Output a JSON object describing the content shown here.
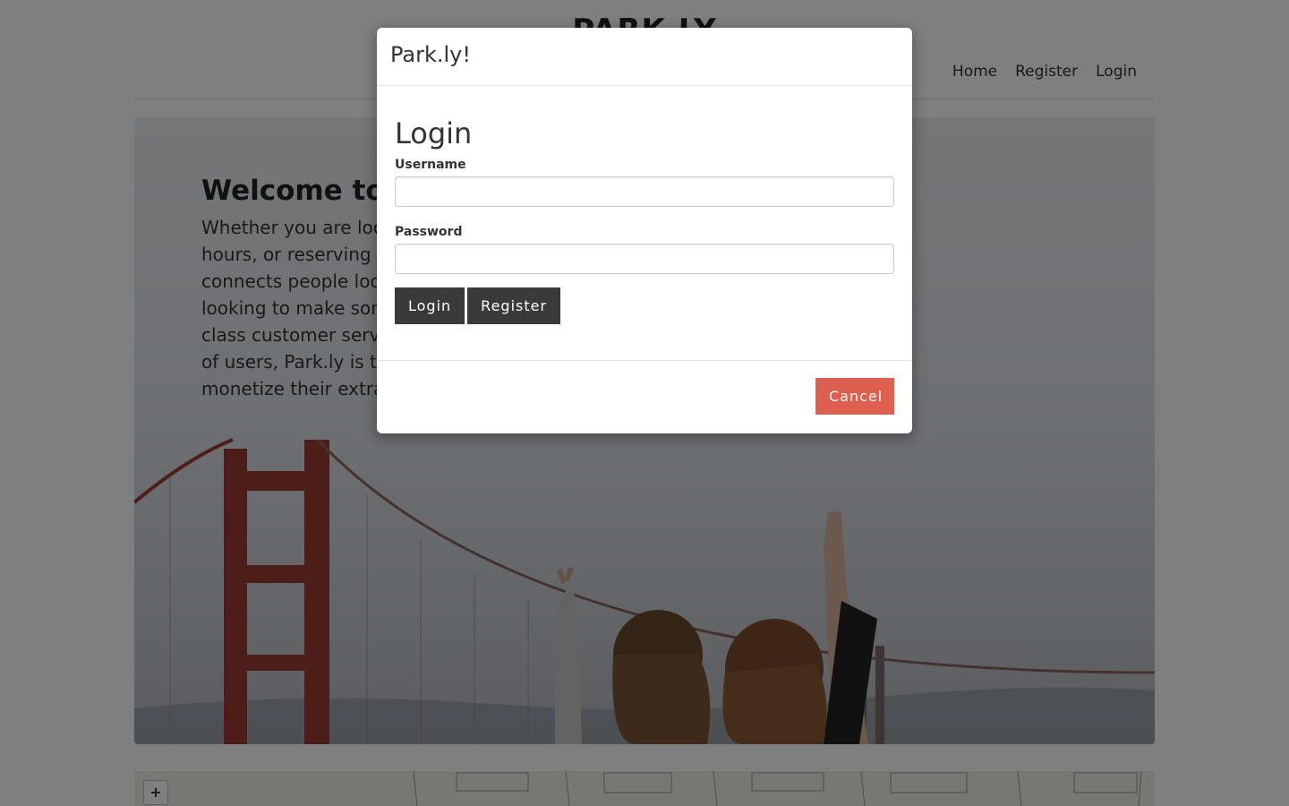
{
  "page": {
    "brand": "PARK.LY",
    "nav": [
      {
        "label": "Home"
      },
      {
        "label": "Register"
      },
      {
        "label": "Login"
      }
    ],
    "hero": {
      "title": "Welcome to Park.ly",
      "body_lines": [
        "Whether you are looking for a spot for a few",
        "hours, or reserving a spot for a month, Park.ly",
        "connects people looking for parking with people",
        "looking to make some extra money. With first",
        "class customer service and a growing community",
        "of users, Park.ly is the easiest way to park and",
        "monetize their extra space."
      ]
    },
    "map": {
      "zoom_in": "+"
    }
  },
  "modal": {
    "title": "Park.ly!",
    "heading": "Login",
    "username_label": "Username",
    "username_value": "",
    "password_label": "Password",
    "password_value": "",
    "login_button": "Login",
    "register_button": "Register",
    "cancel_button": "Cancel"
  },
  "colors": {
    "overlay": "rgba(0,0,0,0.5)",
    "button_dark": "#3a3a3a",
    "cancel_red": "#dc5f4f"
  }
}
